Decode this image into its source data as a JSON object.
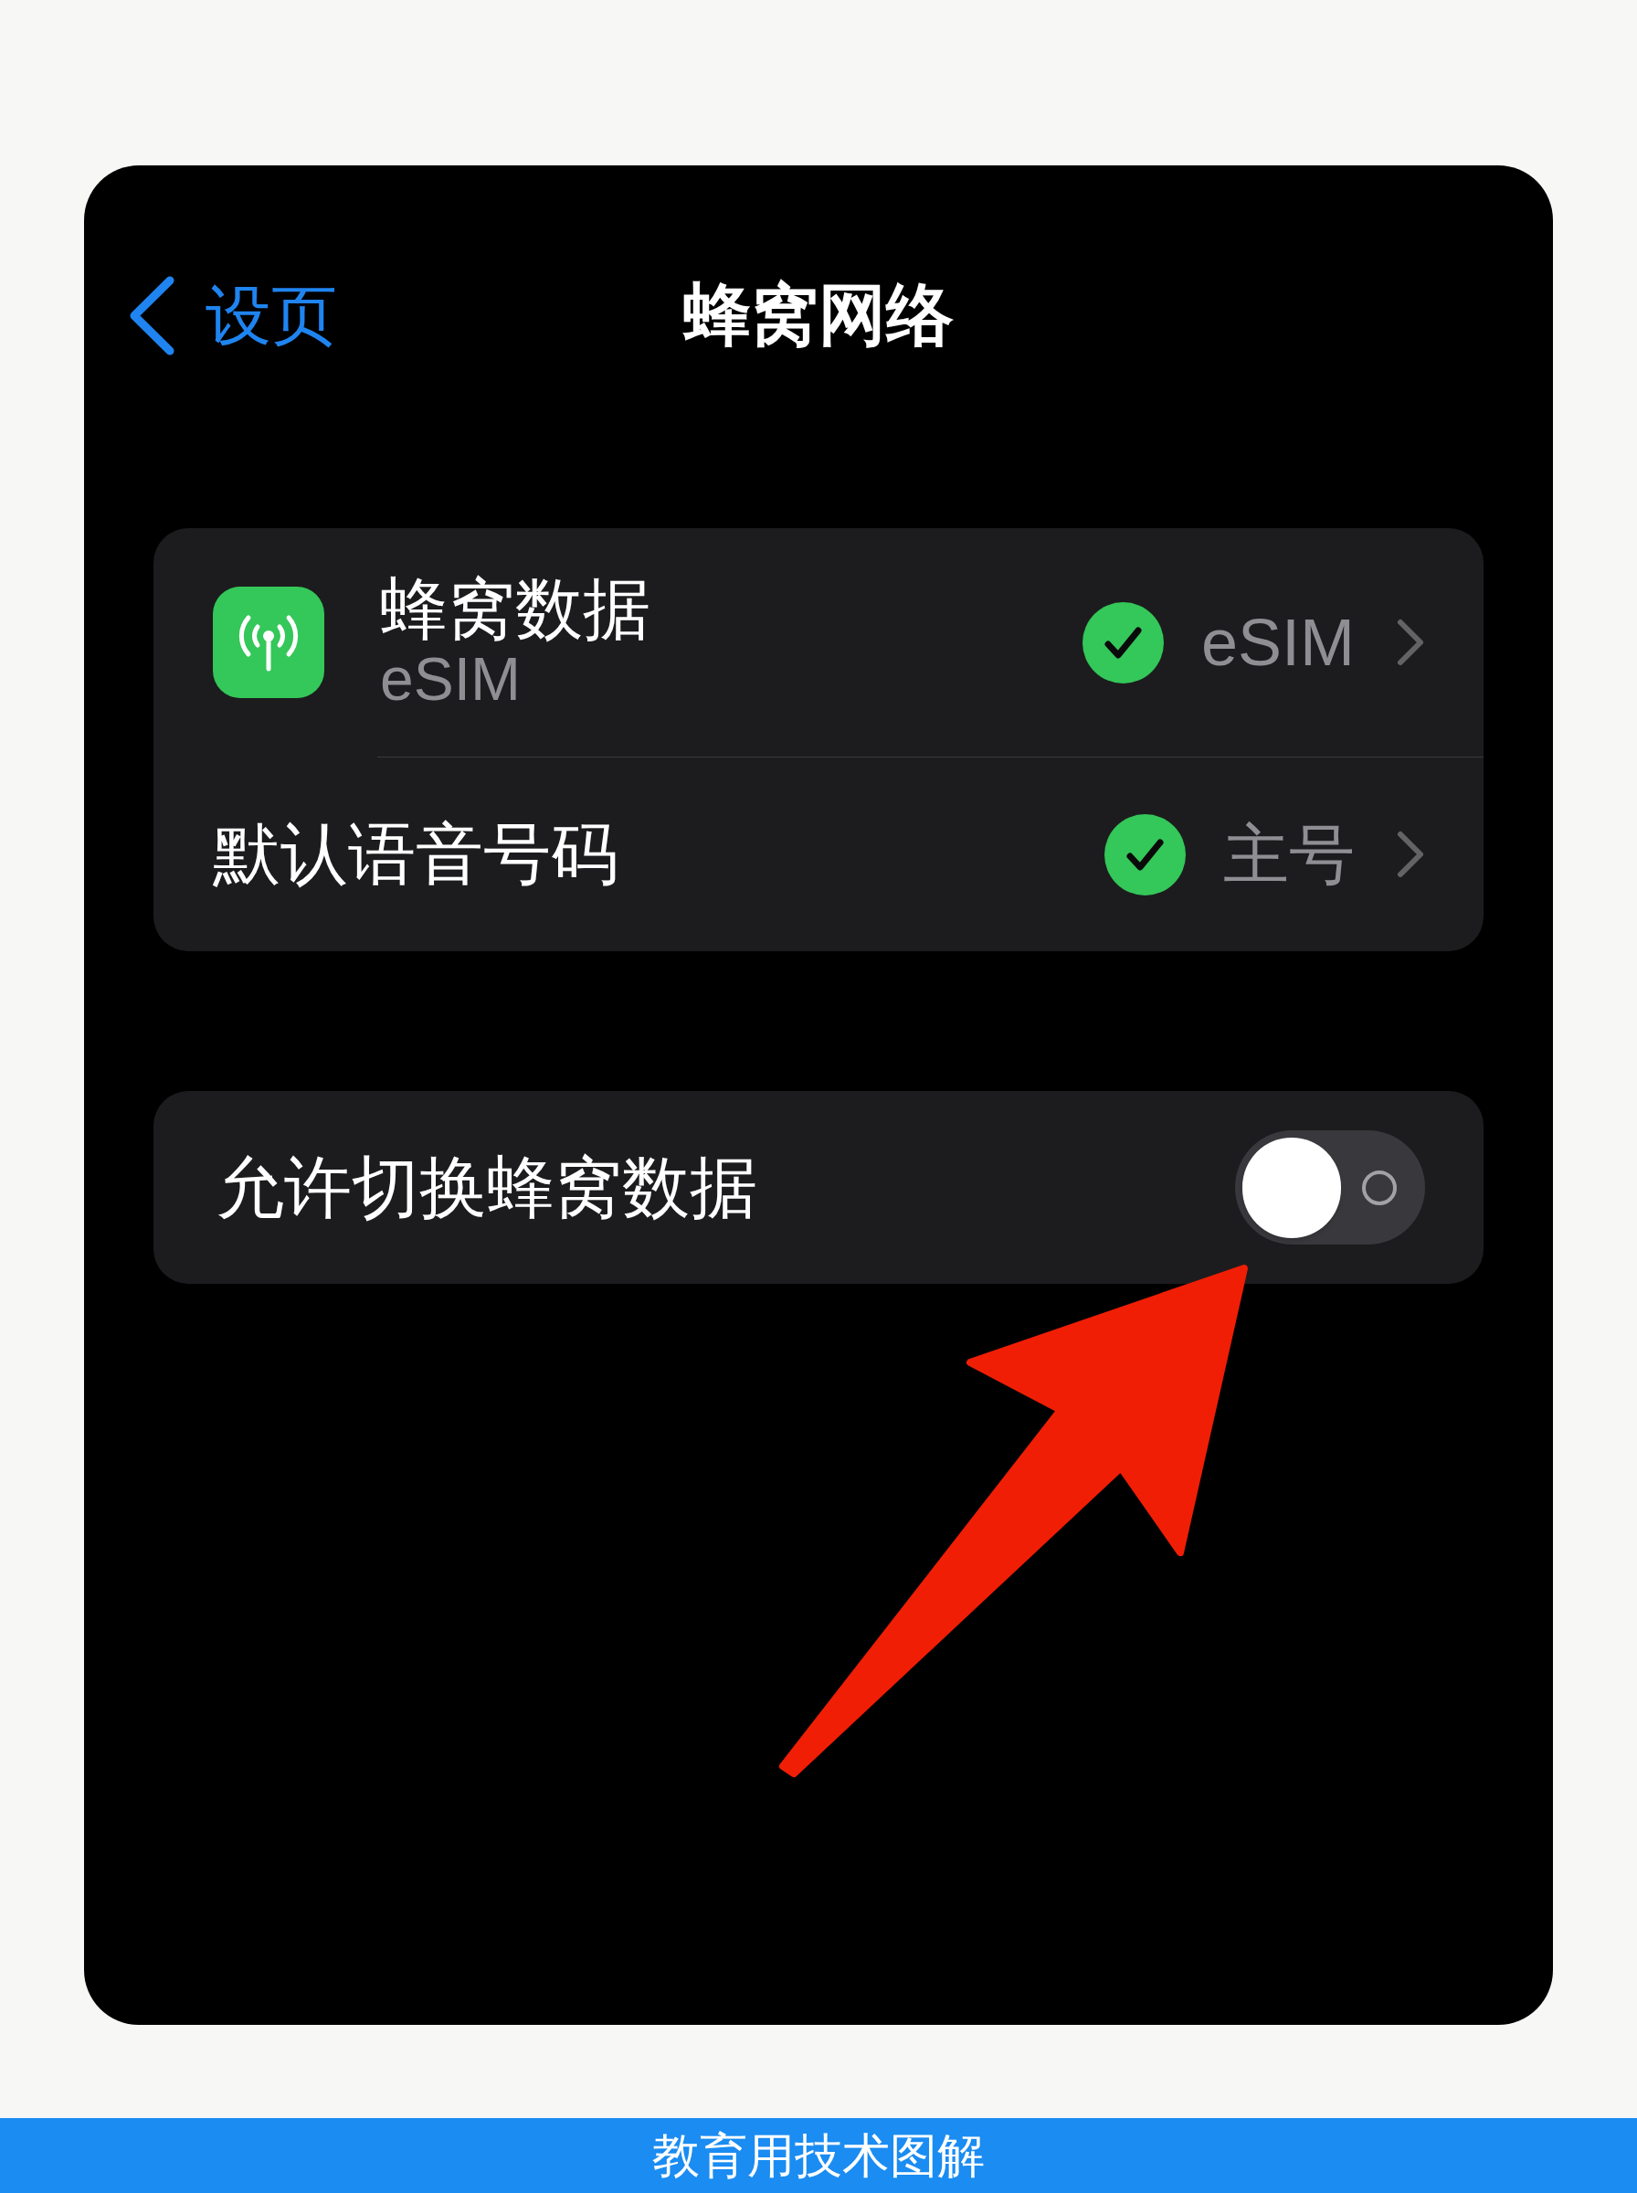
{
  "nav": {
    "back_label": "设页",
    "title": "蜂窝网络"
  },
  "groups": [
    {
      "rows": [
        {
          "kind": "app_detail",
          "title": "蜂窝数据",
          "subtitle": "eSIM",
          "checked": true,
          "value": "eSIM"
        },
        {
          "kind": "detail",
          "title": "默认语音号码",
          "checked": true,
          "value": "主号"
        }
      ]
    },
    {
      "rows": [
        {
          "kind": "toggle",
          "title": "允许切换蜂窝数据",
          "on": false
        }
      ]
    }
  ],
  "caption_banner": {
    "text": "教育用技术图解"
  }
}
